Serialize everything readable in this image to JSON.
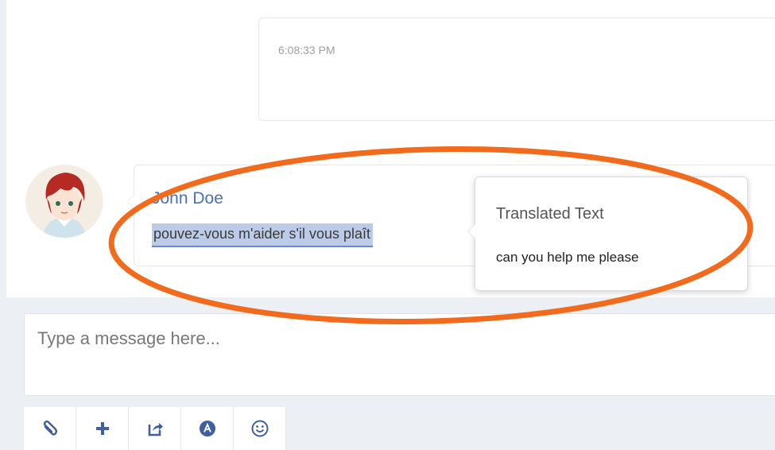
{
  "conversation": {
    "previous_message": {
      "timestamp": "6:08:33 PM"
    },
    "current_message": {
      "sender": "John Doe",
      "text": "pouvez-vous m'aider s'il vous plaît"
    }
  },
  "translation_popup": {
    "title": "Translated Text",
    "translated_text": "can you help me please"
  },
  "composer": {
    "placeholder": "Type a message here..."
  },
  "toolbar": {
    "buttons": [
      {
        "icon": "paperclip-icon"
      },
      {
        "icon": "plus-icon"
      },
      {
        "icon": "share-icon"
      },
      {
        "icon": "font-icon"
      },
      {
        "icon": "smiley-icon"
      }
    ]
  },
  "colors": {
    "accent": "#4a6fb5",
    "selection": "#bccbe8",
    "annotation": "#f26a1b",
    "background": "#eceff4"
  }
}
